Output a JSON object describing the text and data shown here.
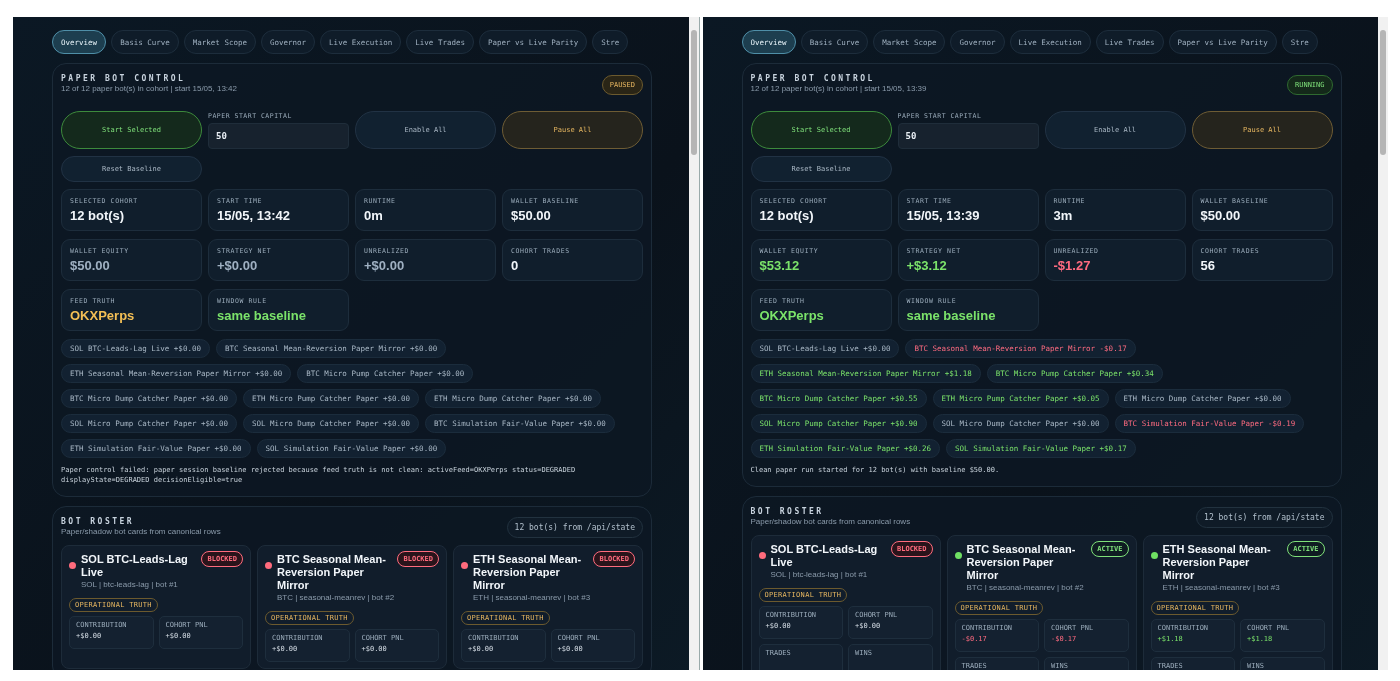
{
  "panes": [
    {
      "tabs": [
        {
          "label": "Overview",
          "selected": true
        },
        {
          "label": "Basis Curve",
          "selected": false
        },
        {
          "label": "Market Scope",
          "selected": false
        },
        {
          "label": "Governor",
          "selected": false
        },
        {
          "label": "Live Execution",
          "selected": false
        },
        {
          "label": "Live Trades",
          "selected": false
        },
        {
          "label": "Paper vs Live Parity",
          "selected": false
        },
        {
          "label": "Stre",
          "selected": false
        }
      ],
      "control": {
        "title": "PAPER BOT CONTROL",
        "subtitle": "12 of 12 paper bot(s) in cohort | start 15/05, 13:42",
        "status": {
          "label": "PAUSED",
          "kind": "paused"
        },
        "actions": [
          {
            "kind": "start",
            "label": "Start Selected"
          },
          {
            "kind": "field",
            "label": "PAPER START CAPITAL",
            "value": "50"
          },
          {
            "kind": "neutral",
            "label": "Enable All"
          },
          {
            "kind": "pause",
            "label": "Pause All"
          },
          {
            "kind": "small",
            "label": "Reset Baseline"
          }
        ],
        "stats": [
          {
            "label": "SELECTED COHORT",
            "value": "12 bot(s)",
            "color": "#f2f6fa"
          },
          {
            "label": "START TIME",
            "value": "15/05, 13:42",
            "color": "#f2f6fa"
          },
          {
            "label": "RUNTIME",
            "value": "0m",
            "color": "#f2f6fa"
          },
          {
            "label": "WALLET BASELINE",
            "value": "$50.00",
            "color": "#f2f6fa"
          },
          {
            "label": "WALLET EQUITY",
            "value": "$50.00",
            "color": "#9fb0c2"
          },
          {
            "label": "STRATEGY NET",
            "value": "+$0.00",
            "color": "#9fb0c2"
          },
          {
            "label": "UNREALIZED",
            "value": "+$0.00",
            "color": "#9fb0c2"
          },
          {
            "label": "COHORT TRADES",
            "value": "0",
            "color": "#f2f6fa"
          },
          {
            "label": "FEED TRUTH",
            "value": "OKXPerps",
            "color": "#f3bf55"
          },
          {
            "label": "WINDOW RULE",
            "value": "same baseline",
            "color": "#7be36a"
          }
        ],
        "chips": [
          {
            "label": "SOL BTC-Leads-Lag Live +$0.00",
            "kind": "flat"
          },
          {
            "label": "BTC Seasonal Mean-Reversion Paper Mirror +$0.00",
            "kind": "flat"
          },
          {
            "label": "ETH Seasonal Mean-Reversion Paper Mirror +$0.00",
            "kind": "flat"
          },
          {
            "label": "BTC Micro Pump Catcher Paper +$0.00",
            "kind": "flat"
          },
          {
            "label": "BTC Micro Dump Catcher Paper +$0.00",
            "kind": "flat"
          },
          {
            "label": "ETH Micro Pump Catcher Paper +$0.00",
            "kind": "flat"
          },
          {
            "label": "ETH Micro Dump Catcher Paper +$0.00",
            "kind": "flat"
          },
          {
            "label": "SOL Micro Pump Catcher Paper +$0.00",
            "kind": "flat"
          },
          {
            "label": "SOL Micro Dump Catcher Paper +$0.00",
            "kind": "flat"
          },
          {
            "label": "BTC Simulation Fair-Value Paper +$0.00",
            "kind": "flat"
          },
          {
            "label": "ETH Simulation Fair-Value Paper +$0.00",
            "kind": "flat"
          },
          {
            "label": "SOL Simulation Fair-Value Paper +$0.00",
            "kind": "flat"
          }
        ],
        "message": "Paper control failed: paper session baseline rejected because feed truth is not clean: activeFeed=OKXPerps status=DEGRADED displayState=DEGRADED decisionEligible=true"
      },
      "roster": {
        "title": "BOT ROSTER",
        "subtitle": "Paper/shadow bot cards from canonical rows",
        "source": "12 bot(s) from /api/state",
        "bots": [
          {
            "name": "SOL BTC-Leads-Lag Live",
            "meta": "SOL | btc-leads-lag | bot #1",
            "status": {
              "label": "BLOCKED",
              "kind": "blocked"
            },
            "badge": "OPERATIONAL TRUTH",
            "metrics": [
              {
                "label": "CONTRIBUTION",
                "value": "+$0.00",
                "kind": "flat"
              },
              {
                "label": "COHORT PNL",
                "value": "+$0.00",
                "kind": "flat"
              }
            ]
          },
          {
            "name": "BTC Seasonal Mean-Reversion Paper Mirror",
            "meta": "BTC | seasonal-meanrev | bot #2",
            "status": {
              "label": "BLOCKED",
              "kind": "blocked"
            },
            "badge": "OPERATIONAL TRUTH",
            "metrics": [
              {
                "label": "CONTRIBUTION",
                "value": "+$0.00",
                "kind": "flat"
              },
              {
                "label": "COHORT PNL",
                "value": "+$0.00",
                "kind": "flat"
              }
            ]
          },
          {
            "name": "ETH Seasonal Mean-Reversion Paper Mirror",
            "meta": "ETH | seasonal-meanrev | bot #3",
            "status": {
              "label": "BLOCKED",
              "kind": "blocked"
            },
            "badge": "OPERATIONAL TRUTH",
            "metrics": [
              {
                "label": "CONTRIBUTION",
                "value": "+$0.00",
                "kind": "flat"
              },
              {
                "label": "COHORT PNL",
                "value": "+$0.00",
                "kind": "flat"
              }
            ]
          }
        ]
      }
    },
    {
      "tabs": [
        {
          "label": "Overview",
          "selected": true
        },
        {
          "label": "Basis Curve",
          "selected": false
        },
        {
          "label": "Market Scope",
          "selected": false
        },
        {
          "label": "Governor",
          "selected": false
        },
        {
          "label": "Live Execution",
          "selected": false
        },
        {
          "label": "Live Trades",
          "selected": false
        },
        {
          "label": "Paper vs Live Parity",
          "selected": false
        },
        {
          "label": "Stre",
          "selected": false
        }
      ],
      "control": {
        "title": "PAPER BOT CONTROL",
        "subtitle": "12 of 12 paper bot(s) in cohort | start 15/05, 13:39",
        "status": {
          "label": "RUNNING",
          "kind": "running"
        },
        "actions": [
          {
            "kind": "start",
            "label": "Start Selected"
          },
          {
            "kind": "field",
            "label": "PAPER START CAPITAL",
            "value": "50"
          },
          {
            "kind": "neutral",
            "label": "Enable All"
          },
          {
            "kind": "pause",
            "label": "Pause All"
          },
          {
            "kind": "small",
            "label": "Reset Baseline"
          }
        ],
        "stats": [
          {
            "label": "SELECTED COHORT",
            "value": "12 bot(s)",
            "color": "#f2f6fa"
          },
          {
            "label": "START TIME",
            "value": "15/05, 13:39",
            "color": "#f2f6fa"
          },
          {
            "label": "RUNTIME",
            "value": "3m",
            "color": "#f2f6fa"
          },
          {
            "label": "WALLET BASELINE",
            "value": "$50.00",
            "color": "#f2f6fa"
          },
          {
            "label": "WALLET EQUITY",
            "value": "$53.12",
            "color": "#7be36a"
          },
          {
            "label": "STRATEGY NET",
            "value": "+$3.12",
            "color": "#7be36a"
          },
          {
            "label": "UNREALIZED",
            "value": "-$1.27",
            "color": "#ff6b80"
          },
          {
            "label": "COHORT TRADES",
            "value": "56",
            "color": "#f2f6fa"
          },
          {
            "label": "FEED TRUTH",
            "value": "OKXPerps",
            "color": "#7be36a"
          },
          {
            "label": "WINDOW RULE",
            "value": "same baseline",
            "color": "#7be36a"
          }
        ],
        "chips": [
          {
            "label": "SOL BTC-Leads-Lag Live +$0.00",
            "kind": "flat"
          },
          {
            "label": "BTC Seasonal Mean-Reversion Paper Mirror -$0.17",
            "kind": "loss"
          },
          {
            "label": "ETH Seasonal Mean-Reversion Paper Mirror +$1.18",
            "kind": "gain"
          },
          {
            "label": "BTC Micro Pump Catcher Paper +$0.34",
            "kind": "gain"
          },
          {
            "label": "BTC Micro Dump Catcher Paper +$0.55",
            "kind": "gain"
          },
          {
            "label": "ETH Micro Pump Catcher Paper +$0.05",
            "kind": "gain"
          },
          {
            "label": "ETH Micro Dump Catcher Paper +$0.00",
            "kind": "flat"
          },
          {
            "label": "SOL Micro Pump Catcher Paper +$0.90",
            "kind": "gain"
          },
          {
            "label": "SOL Micro Dump Catcher Paper +$0.00",
            "kind": "flat"
          },
          {
            "label": "BTC Simulation Fair-Value Paper -$0.19",
            "kind": "loss"
          },
          {
            "label": "ETH Simulation Fair-Value Paper +$0.26",
            "kind": "gain"
          },
          {
            "label": "SOL Simulation Fair-Value Paper +$0.17",
            "kind": "gain"
          }
        ],
        "message": "Clean paper run started for 12 bot(s) with baseline $50.00."
      },
      "roster": {
        "title": "BOT ROSTER",
        "subtitle": "Paper/shadow bot cards from canonical rows",
        "source": "12 bot(s) from /api/state",
        "bots": [
          {
            "name": "SOL BTC-Leads-Lag Live",
            "meta": "SOL | btc-leads-lag | bot #1",
            "status": {
              "label": "BLOCKED",
              "kind": "blocked"
            },
            "badge": "OPERATIONAL TRUTH",
            "metrics": [
              {
                "label": "CONTRIBUTION",
                "value": "+$0.00",
                "kind": "flat"
              },
              {
                "label": "COHORT PNL",
                "value": "+$0.00",
                "kind": "flat"
              },
              {
                "label": "TRADES"
              },
              {
                "label": "WINS"
              }
            ]
          },
          {
            "name": "BTC Seasonal Mean-Reversion Paper Mirror",
            "meta": "BTC | seasonal-meanrev | bot #2",
            "status": {
              "label": "ACTIVE",
              "kind": "active"
            },
            "badge": "OPERATIONAL TRUTH",
            "metrics": [
              {
                "label": "CONTRIBUTION",
                "value": "-$0.17",
                "kind": "loss"
              },
              {
                "label": "COHORT PNL",
                "value": "-$0.17",
                "kind": "loss"
              },
              {
                "label": "TRADES"
              },
              {
                "label": "WINS"
              }
            ]
          },
          {
            "name": "ETH Seasonal Mean-Reversion Paper Mirror",
            "meta": "ETH | seasonal-meanrev | bot #3",
            "status": {
              "label": "ACTIVE",
              "kind": "active"
            },
            "badge": "OPERATIONAL TRUTH",
            "metrics": [
              {
                "label": "CONTRIBUTION",
                "value": "+$1.18",
                "kind": "gain"
              },
              {
                "label": "COHORT PNL",
                "value": "+$1.18",
                "kind": "gain"
              },
              {
                "label": "TRADES"
              },
              {
                "label": "WINS"
              }
            ]
          }
        ]
      }
    }
  ]
}
